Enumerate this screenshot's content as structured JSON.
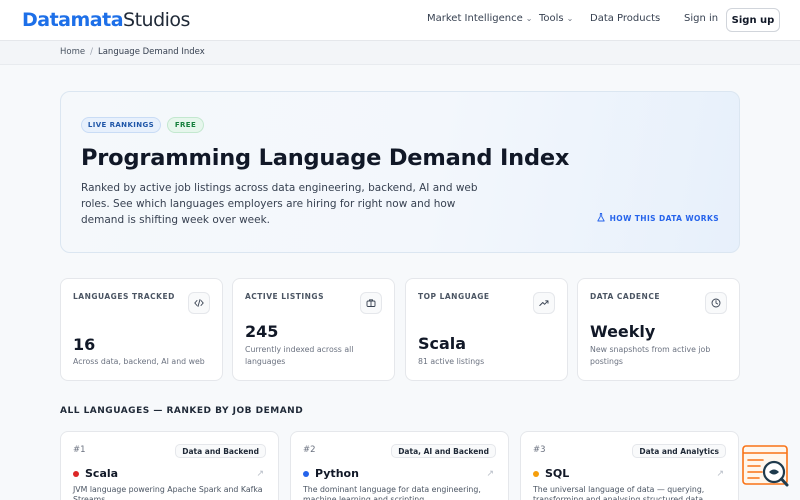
{
  "brand": {
    "name_part1": "Datamata",
    "name_part2": "Studios"
  },
  "nav": {
    "market_intelligence": "Market Intelligence",
    "tools": "Tools",
    "data_products": "Data Products",
    "sign_in": "Sign in",
    "sign_up": "Sign up"
  },
  "breadcrumb": {
    "home": "Home",
    "separator": "/",
    "current": "Language Demand Index"
  },
  "hero": {
    "badge_live": "LIVE RANKINGS",
    "badge_free": "FREE",
    "title": "Programming Language Demand Index",
    "description": "Ranked by active job listings across data engineering, backend, AI and web roles. See which languages employers are hiring for right now and how demand is shifting week over week.",
    "how_link": "HOW THIS DATA WORKS"
  },
  "stats": [
    {
      "label": "LANGUAGES TRACKED",
      "value": "16",
      "sub": "Across data, backend, AI and web",
      "icon": "code-icon"
    },
    {
      "label": "ACTIVE LISTINGS",
      "value": "245",
      "sub": "Currently indexed across all languages",
      "icon": "briefcase-icon"
    },
    {
      "label": "TOP LANGUAGE",
      "value": "Scala",
      "sub": "81 active listings",
      "icon": "trending-up-icon"
    },
    {
      "label": "DATA CADENCE",
      "value": "Weekly",
      "sub": "New snapshots from active job postings",
      "icon": "clock-icon"
    }
  ],
  "section": {
    "title": "ALL LANGUAGES — RANKED BY JOB DEMAND"
  },
  "languages": [
    {
      "rank": "#1",
      "tag": "Data and Backend",
      "name": "Scala",
      "color": "#dc2626",
      "desc": "JVM language powering Apache Spark and Kafka Streams"
    },
    {
      "rank": "#2",
      "tag": "Data, AI and Backend",
      "name": "Python",
      "color": "#2563eb",
      "desc": "The dominant language for data engineering, machine learning and scripting"
    },
    {
      "rank": "#3",
      "tag": "Data and Analytics",
      "name": "SQL",
      "color": "#f59e0b",
      "desc": "The universal language of data — querying, transforming and analysing structured data"
    }
  ],
  "colors": {
    "accent": "#2563eb",
    "brand": "#1d6fe8",
    "widget": "#f97316"
  }
}
